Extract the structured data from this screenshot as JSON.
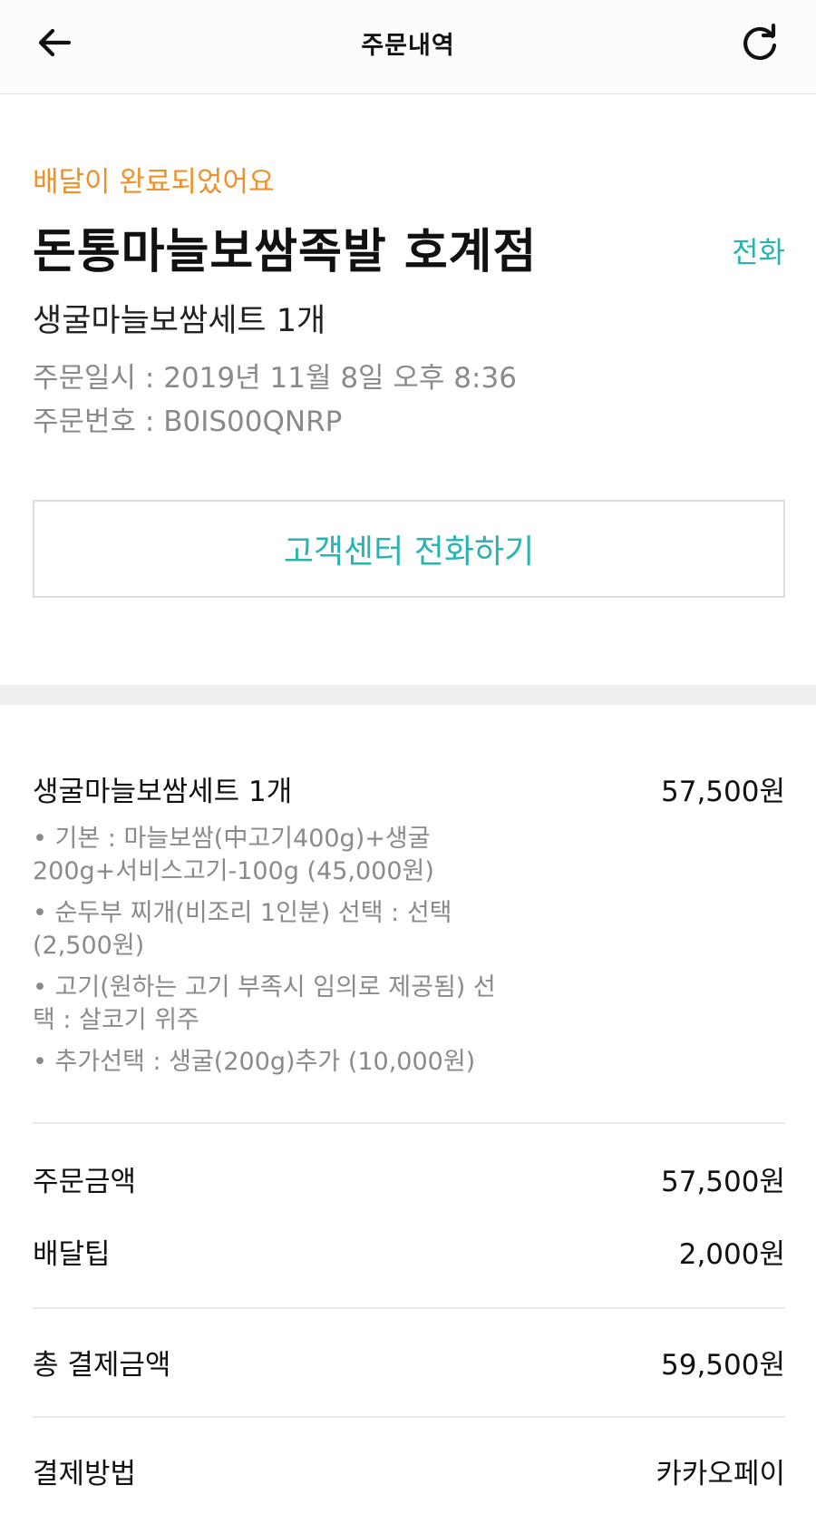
{
  "header": {
    "title": "주문내역",
    "back_icon": "arrow-left-icon",
    "refresh_icon": "refresh-icon"
  },
  "order": {
    "status": "배달이 완료되었어요",
    "store_name": "돈통마늘보쌈족발 호계점",
    "call_label": "전화",
    "summary": "생굴마늘보쌈세트 1개",
    "date_line": "주문일시 : 2019년 11월 8일 오후 8:36",
    "number_line": "주문번호 : B0IS00QNRP",
    "cs_button": "고객센터 전화하기"
  },
  "item": {
    "name": "생굴마늘보쌈세트 1개",
    "price": "57,500원",
    "options": [
      "• 기본 : 마늘보쌈(中고기400g)+생굴 200g+서비스고기-100g (45,000원)",
      "• 순두부 찌개(비조리 1인분) 선택 : 선택 (2,500원)",
      "• 고기(원하는 고기 부족시 임의로 제공됨) 선택 : 살코기 위주",
      "• 추가선택 : 생굴(200g)추가 (10,000원)"
    ]
  },
  "payment": {
    "order_amount_label": "주문금액",
    "order_amount": "57,500원",
    "delivery_tip_label": "배달팁",
    "delivery_tip": "2,000원",
    "total_label": "총 결제금액",
    "total": "59,500원",
    "method_label": "결제방법",
    "method": "카카오페이"
  },
  "colors": {
    "status": "#f0902a",
    "accent": "#2ab3b1"
  }
}
